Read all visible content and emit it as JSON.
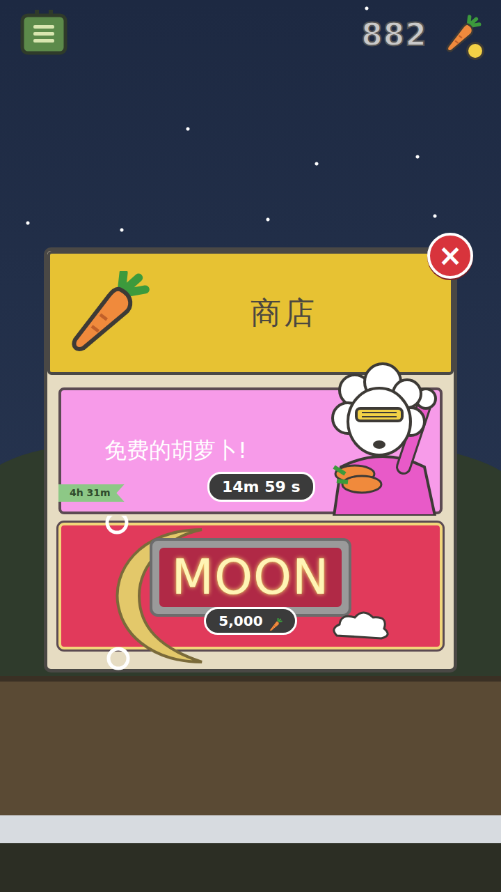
{
  "hud": {
    "carrots": "882"
  },
  "shop": {
    "title": "商店",
    "close": "×",
    "items": [
      {
        "kind": "free",
        "label": "免费的胡萝卜!",
        "timer": "14m 59 s",
        "ribbon": "4h 31m"
      },
      {
        "kind": "moon",
        "label": "MOON",
        "price": "5,000"
      }
    ]
  }
}
